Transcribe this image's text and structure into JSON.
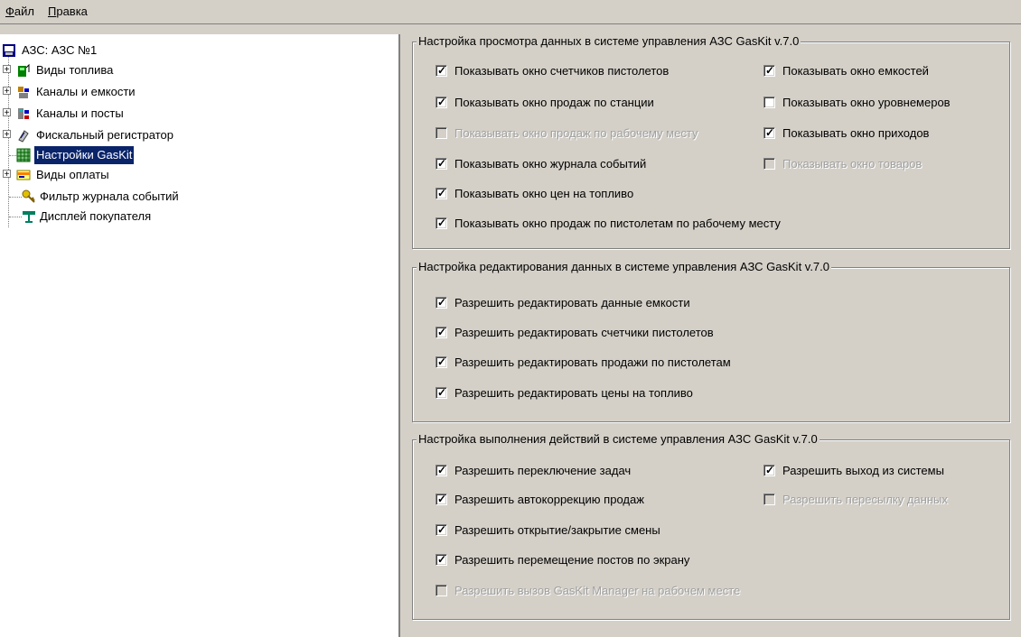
{
  "menu": {
    "file": "Файл",
    "edit": "Правка",
    "file_hotkey": "Ф",
    "file_rest": "айл",
    "edit_hotkey": "П",
    "edit_rest": "равка"
  },
  "tree": {
    "root": "АЗС: АЗС №1",
    "items": [
      {
        "label": "Виды топлива",
        "icon": "fuel-pump-icon",
        "expandable": true
      },
      {
        "label": "Каналы и емкости",
        "icon": "tank-channel-icon",
        "expandable": true
      },
      {
        "label": "Каналы и посты",
        "icon": "post-channel-icon",
        "expandable": true
      },
      {
        "label": "Фискальный регистратор",
        "icon": "fiscal-register-icon",
        "expandable": true
      },
      {
        "label": "Настройки GasKit",
        "icon": "settings-grid-icon",
        "expandable": false,
        "selected": true
      },
      {
        "label": "Виды оплаты",
        "icon": "payment-icon",
        "expandable": true
      },
      {
        "label": "Фильтр журнала событий",
        "icon": "key-filter-icon",
        "expandable": false
      },
      {
        "label": "Дисплей покупателя",
        "icon": "display-icon",
        "expandable": false
      }
    ]
  },
  "view_group": {
    "title": "Настройка просмотра данных в системе управления АЗС GasKit v.7.0",
    "options": [
      {
        "label": "Показывать окно счетчиков пистолетов",
        "checked": true,
        "enabled": true
      },
      {
        "label": "Показывать окно емкостей",
        "checked": true,
        "enabled": true
      },
      {
        "label": "Показывать окно продаж по станции",
        "checked": true,
        "enabled": true
      },
      {
        "label": "Показывать окно уровнемеров",
        "checked": false,
        "enabled": true
      },
      {
        "label": "Показывать окно продаж по рабочему месту",
        "checked": false,
        "enabled": false
      },
      {
        "label": "Показывать окно приходов",
        "checked": true,
        "enabled": true
      },
      {
        "label": "Показывать окно журнала событий",
        "checked": true,
        "enabled": true
      },
      {
        "label": "Показывать окно товаров",
        "checked": false,
        "enabled": false
      },
      {
        "label": "Показывать окно цен на топливо",
        "checked": true,
        "enabled": true
      },
      {
        "label": "Показывать окно продаж по пистолетам по рабочему месту",
        "checked": true,
        "enabled": true
      }
    ]
  },
  "edit_group": {
    "title": "Настройка редактирования данных в системе управления АЗС GasKit v.7.0",
    "options": [
      {
        "label": "Разрешить редактировать данные емкости",
        "checked": true,
        "enabled": true
      },
      {
        "label": "Разрешить редактировать счетчики пистолетов",
        "checked": true,
        "enabled": true
      },
      {
        "label": "Разрешить редактировать продажи по пистолетам",
        "checked": true,
        "enabled": true
      },
      {
        "label": "Разрешить редактировать цены на топливо",
        "checked": true,
        "enabled": true
      }
    ]
  },
  "action_group": {
    "title": "Настройка выполнения действий в системе управления АЗС GasKit v.7.0",
    "options": [
      {
        "label": "Разрешить переключение задач",
        "checked": true,
        "enabled": true
      },
      {
        "label": "Разрешить выход из системы",
        "checked": true,
        "enabled": true
      },
      {
        "label": "Разрешить автокоррекцию продаж",
        "checked": true,
        "enabled": true
      },
      {
        "label": "Разрешить пересылку данных",
        "checked": false,
        "enabled": false
      },
      {
        "label": "Разрешить открытие/закрытие смены",
        "checked": true,
        "enabled": true
      },
      {
        "label": "Разрешить перемещение постов по экрану",
        "checked": true,
        "enabled": true
      },
      {
        "label": "Разрешить вызов GasKit Manager на рабочем месте",
        "checked": false,
        "enabled": false
      }
    ]
  },
  "checkmark": "✓"
}
